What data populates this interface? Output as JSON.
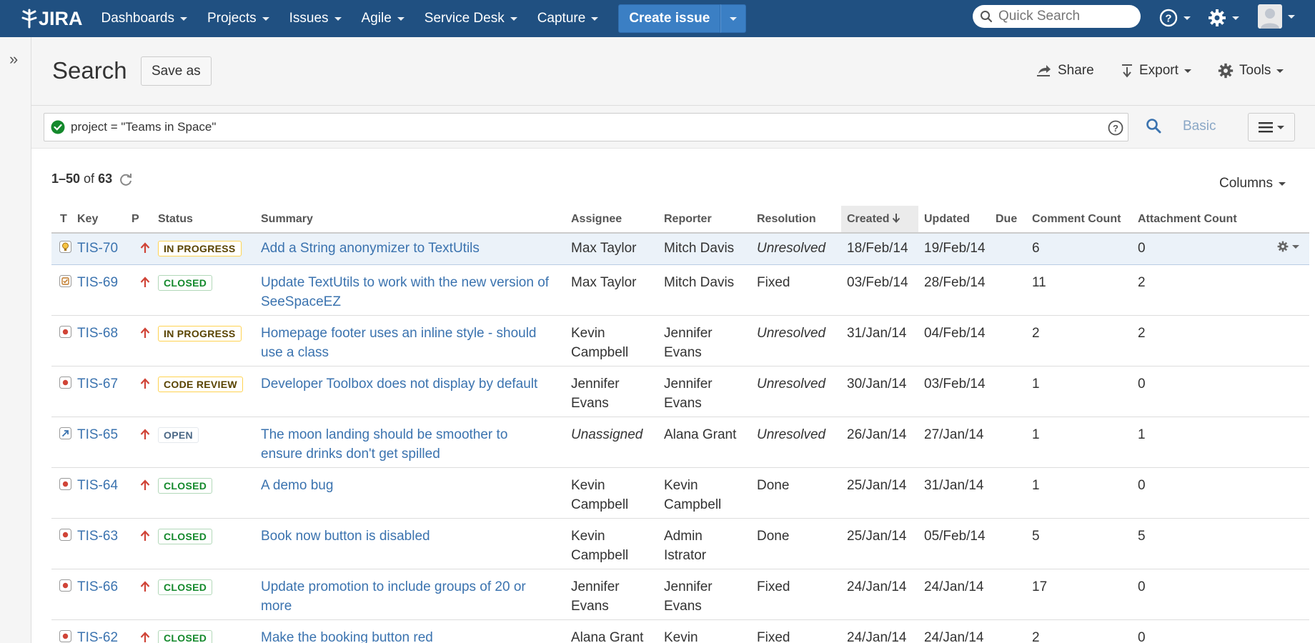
{
  "nav": {
    "logo": "JIRA",
    "items": [
      "Dashboards",
      "Projects",
      "Issues",
      "Agile",
      "Service Desk",
      "Capture"
    ],
    "create_label": "Create issue",
    "quick_search_placeholder": "Quick Search"
  },
  "header": {
    "title": "Search",
    "save_as": "Save as",
    "share": "Share",
    "export": "Export",
    "tools": "Tools"
  },
  "search": {
    "query": "project = \"Teams in Space\"",
    "basic": "Basic"
  },
  "results": {
    "range": "1–50",
    "of": "of",
    "total": "63",
    "columns_label": "Columns"
  },
  "table": {
    "headers": [
      "T",
      "Key",
      "P",
      "Status",
      "Summary",
      "Assignee",
      "Reporter",
      "Resolution",
      "Created",
      "Updated",
      "Due",
      "Comment Count",
      "Attachment Count"
    ],
    "rows": [
      {
        "type": "improvement",
        "key": "TIS-70",
        "status": "IN PROGRESS",
        "status_kind": "progress",
        "summary": [
          "Add a String anonymizer to TextUtils"
        ],
        "assignee": [
          "Max Taylor"
        ],
        "assignee_italic": false,
        "reporter": [
          "Mitch Davis"
        ],
        "resolution": "Unresolved",
        "resolution_italic": true,
        "created": "18/Feb/14",
        "updated": "19/Feb/14",
        "due": "",
        "comments": "6",
        "attachments": "0"
      },
      {
        "type": "task",
        "key": "TIS-69",
        "status": "CLOSED",
        "status_kind": "closed",
        "summary": [
          "Update TextUtils to work with the new version of",
          "SeeSpaceEZ"
        ],
        "assignee": [
          "Max Taylor"
        ],
        "assignee_italic": false,
        "reporter": [
          "Mitch Davis"
        ],
        "resolution": "Fixed",
        "resolution_italic": false,
        "created": "03/Feb/14",
        "updated": "28/Feb/14",
        "due": "",
        "comments": "11",
        "attachments": "2"
      },
      {
        "type": "bug",
        "key": "TIS-68",
        "status": "IN PROGRESS",
        "status_kind": "progress",
        "summary": [
          "Homepage footer uses an inline style - should",
          "use a class"
        ],
        "assignee": [
          "Kevin",
          "Campbell"
        ],
        "assignee_italic": false,
        "reporter": [
          "Jennifer",
          "Evans"
        ],
        "resolution": "Unresolved",
        "resolution_italic": true,
        "created": "31/Jan/14",
        "updated": "04/Feb/14",
        "due": "",
        "comments": "2",
        "attachments": "2"
      },
      {
        "type": "bug",
        "key": "TIS-67",
        "status": "CODE REVIEW",
        "status_kind": "progress",
        "summary": [
          "Developer Toolbox does not display by default"
        ],
        "assignee": [
          "Jennifer",
          "Evans"
        ],
        "assignee_italic": false,
        "reporter": [
          "Jennifer",
          "Evans"
        ],
        "resolution": "Unresolved",
        "resolution_italic": true,
        "created": "30/Jan/14",
        "updated": "03/Feb/14",
        "due": "",
        "comments": "1",
        "attachments": "0"
      },
      {
        "type": "story",
        "key": "TIS-65",
        "status": "OPEN",
        "status_kind": "open",
        "summary": [
          "The moon landing should be smoother to",
          "ensure drinks don't get spilled"
        ],
        "assignee": [
          "Unassigned"
        ],
        "assignee_italic": true,
        "reporter": [
          "Alana Grant"
        ],
        "resolution": "Unresolved",
        "resolution_italic": true,
        "created": "26/Jan/14",
        "updated": "27/Jan/14",
        "due": "",
        "comments": "1",
        "attachments": "1"
      },
      {
        "type": "bug",
        "key": "TIS-64",
        "status": "CLOSED",
        "status_kind": "closed",
        "summary": [
          "A demo bug"
        ],
        "assignee": [
          "Kevin",
          "Campbell"
        ],
        "assignee_italic": false,
        "reporter": [
          "Kevin",
          "Campbell"
        ],
        "resolution": "Done",
        "resolution_italic": false,
        "created": "25/Jan/14",
        "updated": "31/Jan/14",
        "due": "",
        "comments": "1",
        "attachments": "0"
      },
      {
        "type": "bug",
        "key": "TIS-63",
        "status": "CLOSED",
        "status_kind": "closed",
        "summary": [
          "Book now button is disabled"
        ],
        "assignee": [
          "Kevin",
          "Campbell"
        ],
        "assignee_italic": false,
        "reporter": [
          "Admin",
          "Istrator"
        ],
        "resolution": "Done",
        "resolution_italic": false,
        "created": "25/Jan/14",
        "updated": "05/Feb/14",
        "due": "",
        "comments": "5",
        "attachments": "5"
      },
      {
        "type": "bug",
        "key": "TIS-66",
        "status": "CLOSED",
        "status_kind": "closed",
        "summary": [
          "Update promotion to include groups of 20 or",
          "more"
        ],
        "assignee": [
          "Jennifer",
          "Evans"
        ],
        "assignee_italic": false,
        "reporter": [
          "Jennifer",
          "Evans"
        ],
        "resolution": "Fixed",
        "resolution_italic": false,
        "created": "24/Jan/14",
        "updated": "24/Jan/14",
        "due": "",
        "comments": "17",
        "attachments": "0"
      },
      {
        "type": "bug",
        "key": "TIS-62",
        "status": "CLOSED",
        "status_kind": "closed",
        "summary": [
          "Make the booking button red"
        ],
        "assignee": [
          "Alana Grant"
        ],
        "assignee_italic": false,
        "reporter": [
          "Kevin"
        ],
        "resolution": "Fixed",
        "resolution_italic": false,
        "created": "24/Jan/14",
        "updated": "24/Jan/14",
        "due": "",
        "comments": "2",
        "attachments": "0"
      }
    ]
  },
  "colors": {
    "nav_bg": "#205081",
    "link": "#3b73af",
    "priority": "#d04437"
  }
}
